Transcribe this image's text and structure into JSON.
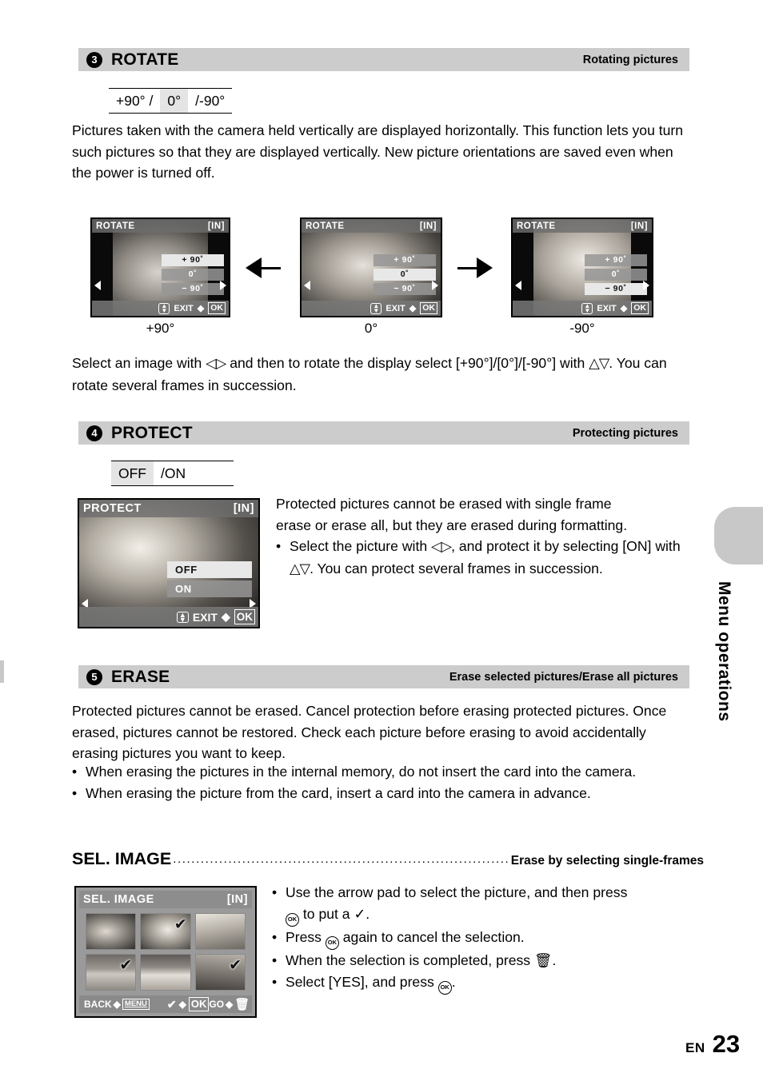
{
  "page": {
    "lang_code": "EN",
    "number": "23"
  },
  "side_tab": {
    "label": "Menu operations"
  },
  "sections": {
    "rotate": {
      "number": "3",
      "title": "ROTATE",
      "subtitle": "Rotating pictures",
      "options": [
        {
          "label": "+90° /",
          "selected": false
        },
        {
          "label": "0°",
          "selected": true
        },
        {
          "label": "/-90°",
          "selected": false
        }
      ],
      "body": "Pictures taken with the camera held vertically are displayed horizontally. This function lets you turn such pictures so that they are displayed vertically. New picture orientations are saved even when the power is turned off.",
      "screens": [
        {
          "title": "ROTATE",
          "memory": "[IN]",
          "caption": "+90°",
          "menu": [
            {
              "label": "+ 90˚",
              "selected": true
            },
            {
              "label": "0˚",
              "selected": false
            },
            {
              "label": "− 90˚",
              "selected": false
            }
          ],
          "bottom_exit": "EXIT",
          "bottom_ok": "OK"
        },
        {
          "title": "ROTATE",
          "memory": "[IN]",
          "caption": "0°",
          "menu": [
            {
              "label": "+ 90˚",
              "selected": false
            },
            {
              "label": "0˚",
              "selected": true
            },
            {
              "label": "− 90˚",
              "selected": false
            }
          ],
          "bottom_exit": "EXIT",
          "bottom_ok": "OK"
        },
        {
          "title": "ROTATE",
          "memory": "[IN]",
          "caption": "-90°",
          "menu": [
            {
              "label": "+ 90˚",
              "selected": false
            },
            {
              "label": "0˚",
              "selected": false
            },
            {
              "label": "− 90˚",
              "selected": true
            }
          ],
          "bottom_exit": "EXIT",
          "bottom_ok": "OK"
        }
      ],
      "instruction_line1_a": "Select an image with",
      "instruction_line1_b": "and then to rotate the display select [+90°]/[0°]/[-90°] with",
      "instruction_line2": ". You can rotate several frames in succession."
    },
    "protect": {
      "number": "4",
      "title": "PROTECT",
      "subtitle": "Protecting pictures",
      "options": [
        {
          "label": "OFF",
          "selected": true
        },
        {
          "label": "/ON",
          "selected": false
        }
      ],
      "screen": {
        "title": "PROTECT",
        "memory": "[IN]",
        "menu": [
          {
            "label": "OFF",
            "selected": true
          },
          {
            "label": "ON",
            "selected": false
          }
        ],
        "bottom_exit": "EXIT",
        "bottom_ok": "OK"
      },
      "body_line1": "Protected pictures cannot be erased with single frame",
      "body_line2": "erase or erase all, but they are erased during formatting.",
      "bullet1_a": "Select the picture with",
      "bullet1_b": ", and protect it by selecting",
      "bullet1_c": "[ON] with",
      "bullet1_d": ". You can protect several frames in",
      "bullet1_e": "succession."
    },
    "erase": {
      "number": "5",
      "title": "ERASE",
      "subtitle": "Erase selected pictures/Erase all pictures",
      "body": "Protected pictures cannot be erased. Cancel protection before erasing protected pictures. Once erased, pictures cannot be restored. Check each picture before erasing to avoid accidentally erasing pictures you want to keep.",
      "bullets": [
        "When erasing the pictures in the internal memory, do not insert the card into the camera.",
        "When erasing the picture from the card, insert a card into the camera in advance."
      ],
      "sel_image": {
        "heading": "SEL. IMAGE",
        "heading_right": "Erase by selecting single-frames",
        "screen": {
          "title": "SEL. IMAGE",
          "memory": "[IN]",
          "thumbnails": [
            {
              "index": 1,
              "checked": false
            },
            {
              "index": 2,
              "checked": true
            },
            {
              "index": 3,
              "checked": false
            },
            {
              "index": 4,
              "checked": true
            },
            {
              "index": 5,
              "checked": false
            },
            {
              "index": 6,
              "checked": true
            }
          ],
          "bar_back": "BACK",
          "bar_menu": "MENU",
          "bar_check": "✔",
          "bar_ok": "OK",
          "bar_go": "GO"
        },
        "bullet1_a": "Use the arrow pad to select the picture, and then press",
        "bullet1_b": "to put a",
        "bullet2_a": "Press",
        "bullet2_b": "again to cancel the selection.",
        "bullet3_a": "When the selection is completed, press",
        "bullet4_a": "Select [YES], and press"
      }
    }
  },
  "colors": {
    "section_bar": "#cccccc",
    "option_selected": "#e4e4e4",
    "side_tab": "#c8c8c8"
  }
}
